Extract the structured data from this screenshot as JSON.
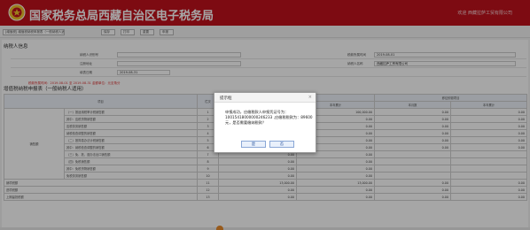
{
  "header": {
    "title": "国家税务总局西藏自治区电子税务局",
    "user_info": "欢迎 西藏拉萨工贸有限公司",
    "brand_color": "#c0121c"
  },
  "toolbar": {
    "items": [
      "[增值税] 增值税纳税申报表（一般纳税人适用）",
      "保存",
      "打印",
      "重置",
      "申报"
    ]
  },
  "sections": {
    "taxpayer_info": "纳税人信息",
    "table_title": "增值税纳税申报表（一般纳税人适用）"
  },
  "form": {
    "labels": {
      "taxpayer_id": "纳税人识别号",
      "taxpayer_name": "纳税人名称",
      "period_start": "税款所属时间",
      "period_end": "填表日期",
      "address": "注册地址"
    },
    "values": {
      "taxpayer_name": "西藏拉萨工贸有限公司",
      "period_start": "2019-08-01",
      "period_end": "2019-08-31"
    }
  },
  "note": "税款所属时间：2019-08-01 至 2019-08-31   金额单位：元至角分",
  "table": {
    "headers": [
      "项目",
      "",
      "栏次",
      "一般项目",
      "",
      "即征即退项目",
      ""
    ],
    "subheaders": [
      "本月数",
      "本年累计",
      "本月数",
      "本年累计"
    ],
    "group_label": "销售额",
    "rows": [
      {
        "proj": "（一）按适用税率计税销售额",
        "idx": "1",
        "v1": "100,000.00",
        "v2": "100,000.00",
        "v3": "0.00",
        "v4": "0.00"
      },
      {
        "proj": "其中：应税货物销售额",
        "idx": "2",
        "v1": "0.00",
        "v2": "0.00",
        "v3": "0.00",
        "v4": "0.00"
      },
      {
        "proj": "应税劳务销售额",
        "idx": "3",
        "v1": "0.00",
        "v2": "0.00",
        "v3": "0.00",
        "v4": "0.00"
      },
      {
        "proj": "纳税检查调整的销售额",
        "idx": "4",
        "v1": "0.00",
        "v2": "0.00",
        "v3": "0.00",
        "v4": "0.00"
      },
      {
        "proj": "（二）按简易办法计税销售额",
        "idx": "5",
        "v1": "0.00",
        "v2": "0.00",
        "v3": "0.00",
        "v4": "0.00"
      },
      {
        "proj": "其中：纳税检查调整的销售额",
        "idx": "6",
        "v1": "0.00",
        "v2": "0.00",
        "v3": "0.00",
        "v4": "0.00"
      },
      {
        "proj": "（三）免、抵、退办法出口销售额",
        "idx": "7",
        "v1": "0.00",
        "v2": "0.00",
        "v3": "",
        "v4": ""
      },
      {
        "proj": "（四）免税销售额",
        "idx": "8",
        "v1": "0.00",
        "v2": "0.00",
        "v3": "",
        "v4": ""
      },
      {
        "proj": "其中：免税货物销售额",
        "idx": "9",
        "v1": "0.00",
        "v2": "0.00",
        "v3": "",
        "v4": ""
      },
      {
        "proj": "免税劳务销售额",
        "idx": "10",
        "v1": "0.00",
        "v2": "0.00",
        "v3": "",
        "v4": ""
      },
      {
        "proj": "销项税额",
        "idx": "11",
        "v1": "13,000.00",
        "v2": "13,000.00",
        "v3": "0.00",
        "v4": "0.00"
      },
      {
        "proj": "进项税额",
        "idx": "12",
        "v1": "0.00",
        "v2": "0.00",
        "v3": "0.00",
        "v4": "0.00"
      },
      {
        "proj": "上期留抵税额",
        "idx": "13",
        "v1": "0.00",
        "v2": "0.00",
        "v3": "0.00",
        "v4": "0.00"
      }
    ]
  },
  "dialog": {
    "title": "提示框",
    "message": "申报成功，应缴税款人申报凭证号为：10015418000000246233 ,应缴税税款为：89600 元，是否需要缴纳税款？",
    "confirm": "是",
    "cancel": "否"
  }
}
